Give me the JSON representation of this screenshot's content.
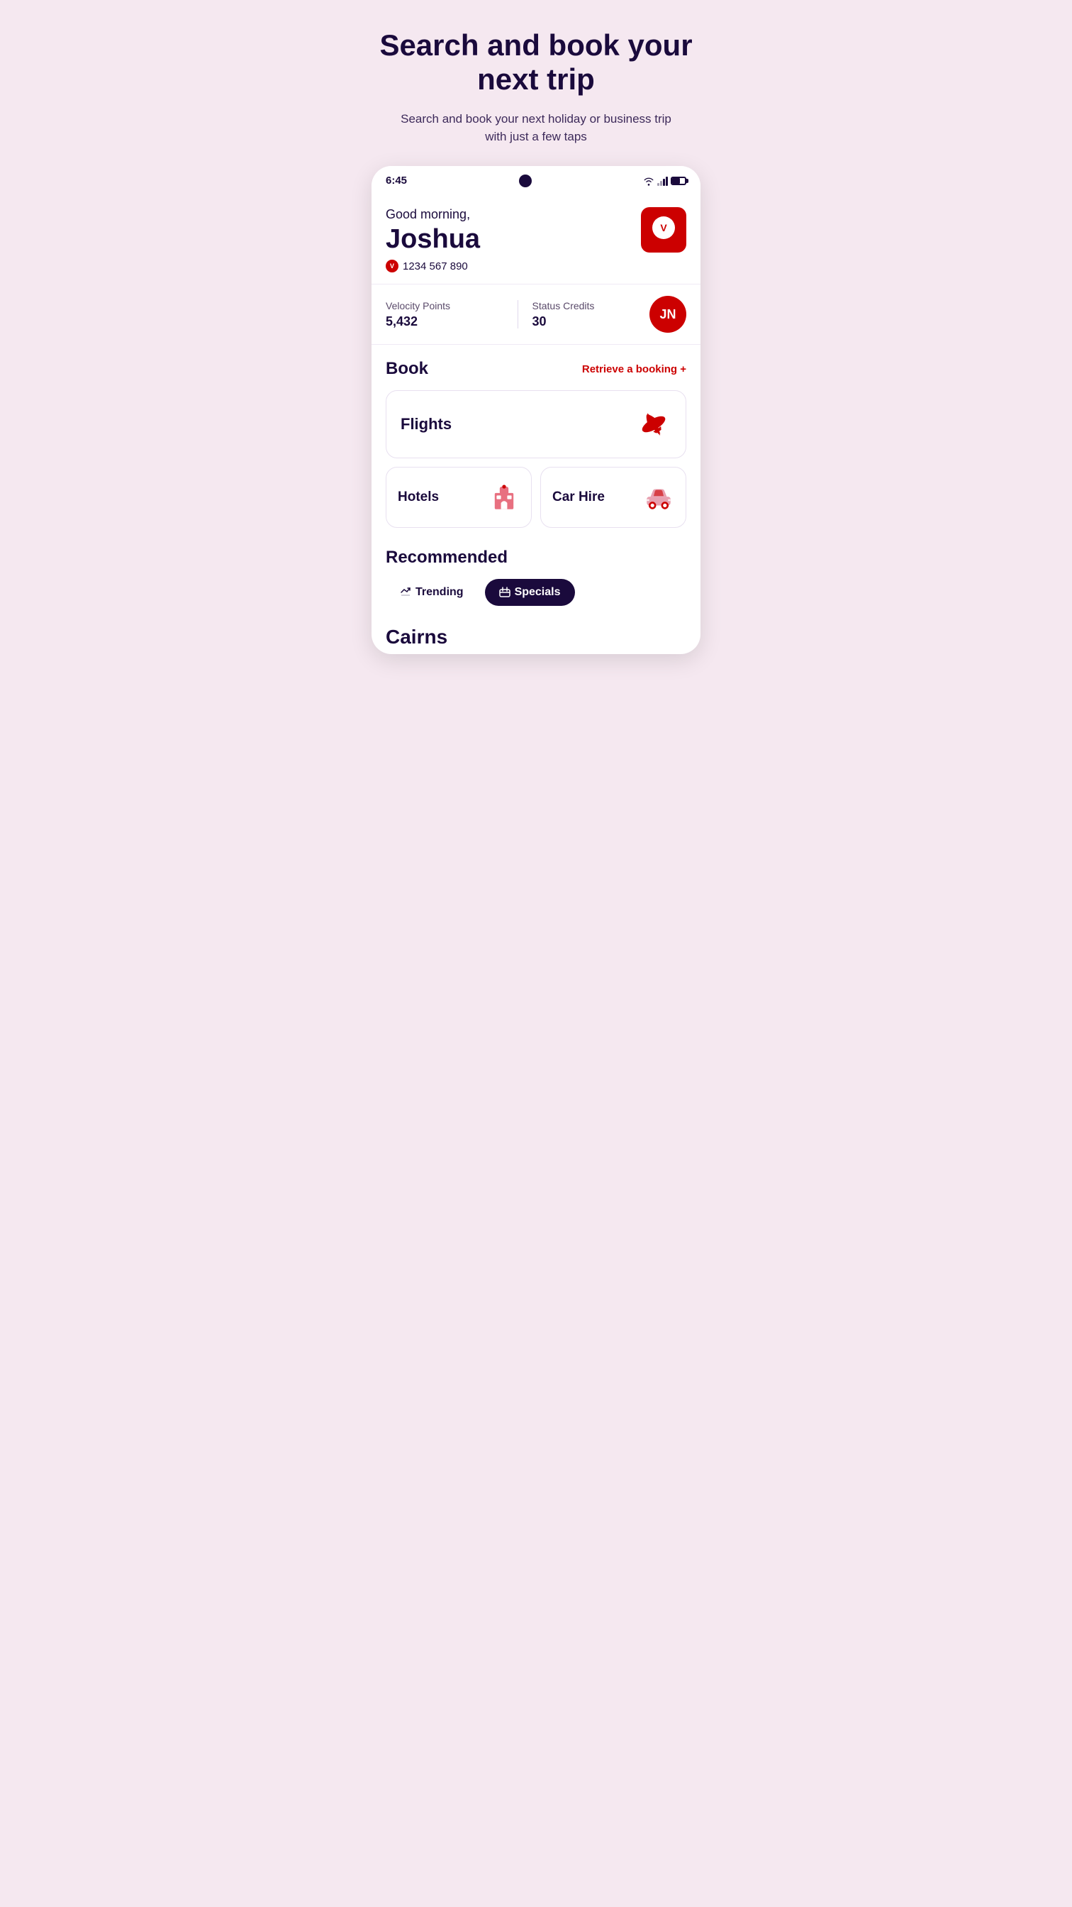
{
  "hero": {
    "title": "Search and book your next trip",
    "subtitle": "Search and book your next holiday or business trip with just a few taps"
  },
  "statusBar": {
    "time": "6:45"
  },
  "profile": {
    "greeting": "Good morning,",
    "userName": "Joshua",
    "membershipNumber": "1234 567 890",
    "avatarInitials": "V",
    "avatarLabel": "JN"
  },
  "points": {
    "velocityLabel": "Velocity Points",
    "velocityValue": "5,432",
    "statusLabel": "Status Credits",
    "statusValue": "30",
    "avatarInitials": "JN"
  },
  "bookSection": {
    "title": "Book",
    "retrieveLabel": "Retrieve a booking +",
    "flightsLabel": "Flights",
    "hotelsLabel": "Hotels",
    "carHireLabel": "Car Hire"
  },
  "recommended": {
    "title": "Recommended",
    "tabs": [
      {
        "label": "Trending",
        "active": false
      },
      {
        "label": "Specials",
        "active": true
      }
    ],
    "destinationName": "Cairns"
  }
}
